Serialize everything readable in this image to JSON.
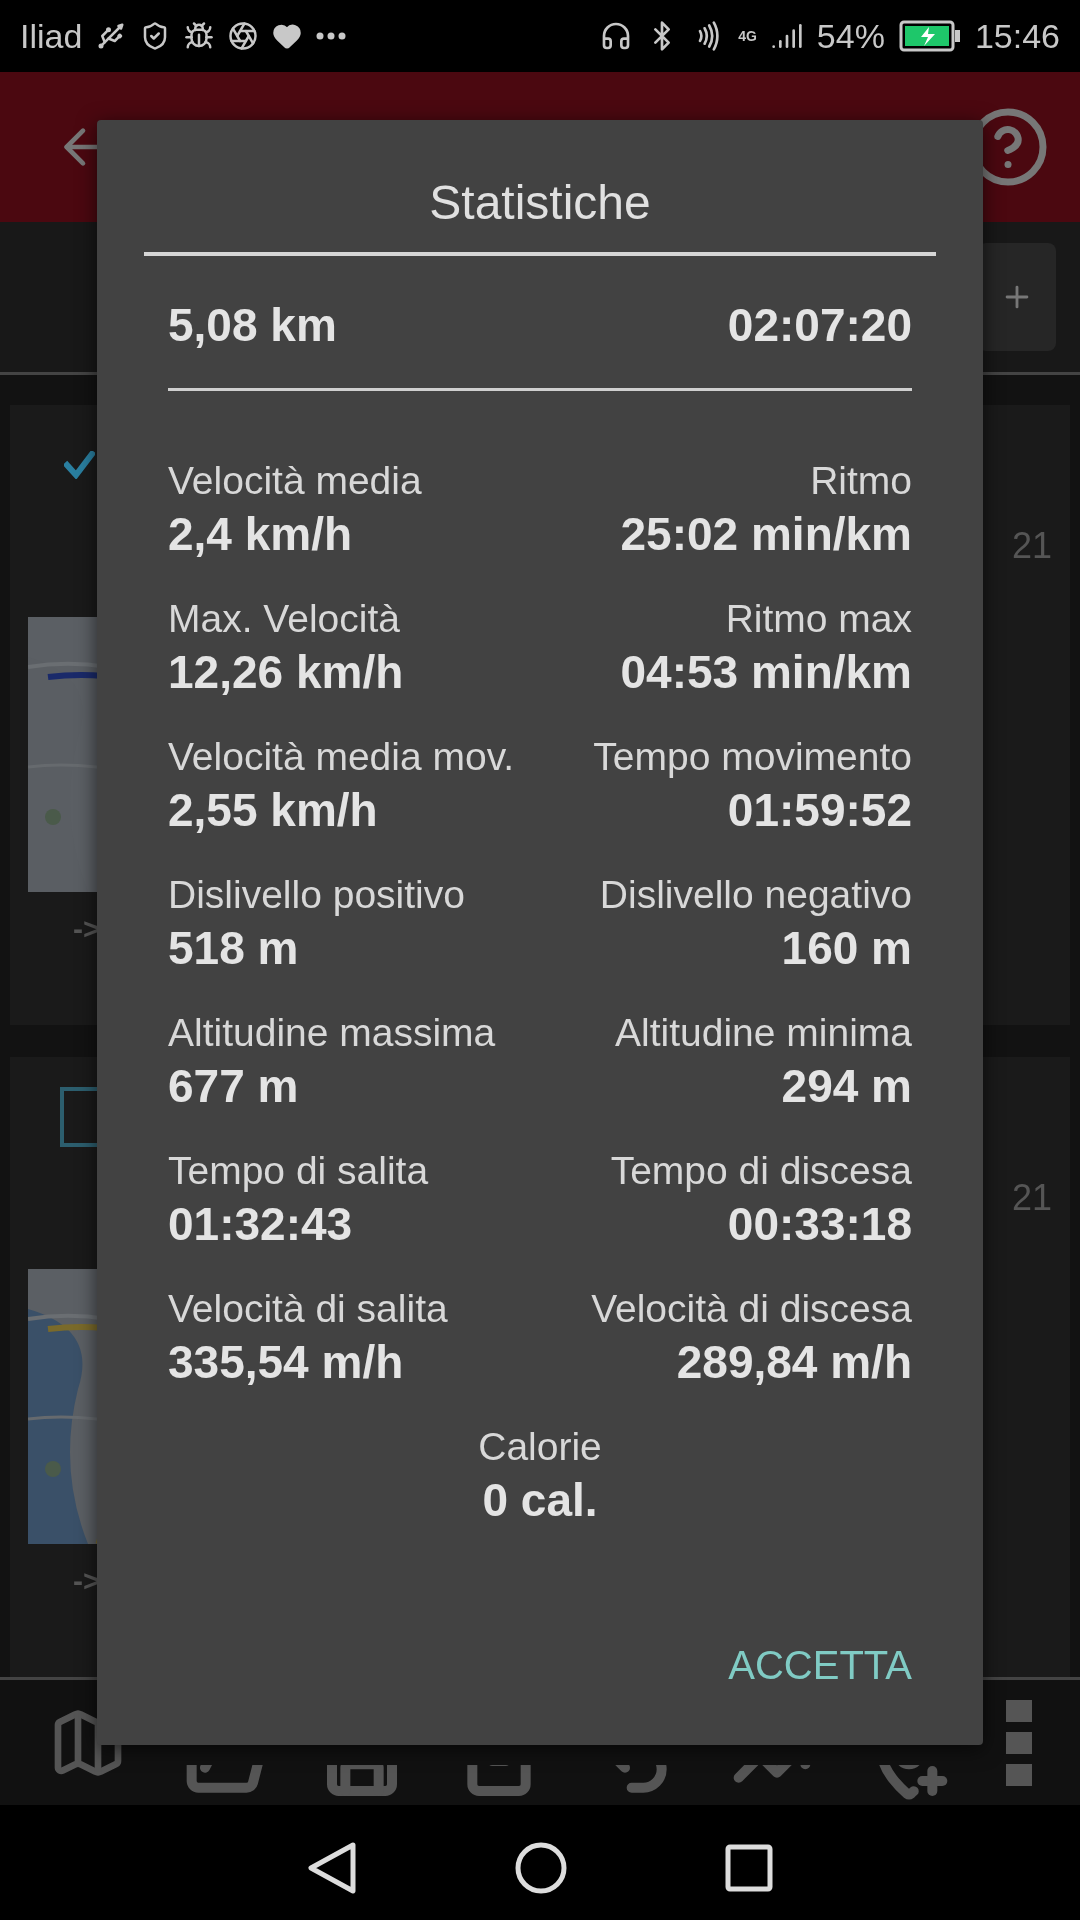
{
  "status_bar": {
    "carrier": "Iliad",
    "battery": "54%",
    "network": "4G",
    "time": "15:46"
  },
  "background": {
    "cards": [
      {
        "checked": true,
        "date_fragment": "21",
        "arrow": "->"
      },
      {
        "checked": false,
        "date_fragment": "21",
        "arrow": "->"
      }
    ]
  },
  "dialog": {
    "title": "Statistiche",
    "summary": {
      "distance": "5,08 km",
      "duration": "02:07:20"
    },
    "rows": [
      [
        {
          "label": "Velocità media",
          "value": "2,4 km/h"
        },
        {
          "label": "Ritmo",
          "value": "25:02 min/km"
        }
      ],
      [
        {
          "label": "Max. Velocità",
          "value": "12,26 km/h"
        },
        {
          "label": "Ritmo max",
          "value": "04:53 min/km"
        }
      ],
      [
        {
          "label": "Velocità media mov.",
          "value": "2,55 km/h"
        },
        {
          "label": "Tempo movimento",
          "value": "01:59:52"
        }
      ],
      [
        {
          "label": "Dislivello positivo",
          "value": "518 m"
        },
        {
          "label": "Dislivello negativo",
          "value": "160 m"
        }
      ],
      [
        {
          "label": "Altitudine massima",
          "value": "677 m"
        },
        {
          "label": "Altitudine minima",
          "value": "294 m"
        }
      ],
      [
        {
          "label": "Tempo di salita",
          "value": "01:32:43"
        },
        {
          "label": "Tempo di discesa",
          "value": "00:33:18"
        }
      ],
      [
        {
          "label": "Velocità di salita",
          "value": "335,54 m/h"
        },
        {
          "label": "Velocità di discesa",
          "value": "289,84 m/h"
        }
      ]
    ],
    "calories": {
      "label": "Calorie",
      "value": "0 cal."
    },
    "button": "ACCETTA"
  }
}
